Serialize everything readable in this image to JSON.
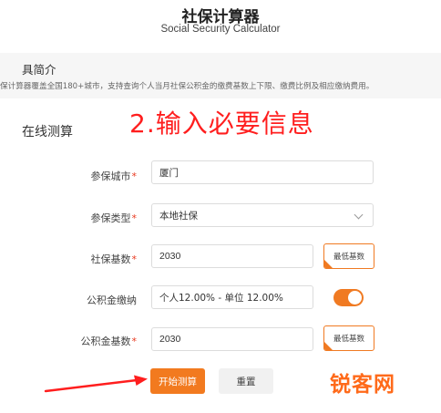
{
  "header": {
    "title_cn": "社保计算器",
    "title_en": "Social Security Calculator"
  },
  "intro": {
    "title": "具简介",
    "text": "保计算器覆盖全国180+城市，支持查询个人当月社保公积金的缴费基数上下限、缴费比例及相应缴纳费用。"
  },
  "section": {
    "title": "在线测算"
  },
  "annotation": "2.输入必要信息",
  "form": {
    "city": {
      "label": "参保城市",
      "required": "*",
      "value": "厦门"
    },
    "type": {
      "label": "参保类型",
      "required": "*",
      "value": "本地社保"
    },
    "ss_base": {
      "label": "社保基数",
      "required": "*",
      "value": "2030",
      "min_button": "最低基数"
    },
    "fund": {
      "label": "公积金缴纳",
      "value": "个人12.00% - 单位 12.00%",
      "toggle_on": true
    },
    "fund_base": {
      "label": "公积金基数",
      "required": "*",
      "value": "2030",
      "min_button": "最低基数"
    }
  },
  "actions": {
    "start": "开始测算",
    "reset": "重置"
  },
  "watermark": "锐客网",
  "colors": {
    "accent": "#f27a1f",
    "annotation": "#ff1e1e",
    "required": "#e8381e"
  }
}
